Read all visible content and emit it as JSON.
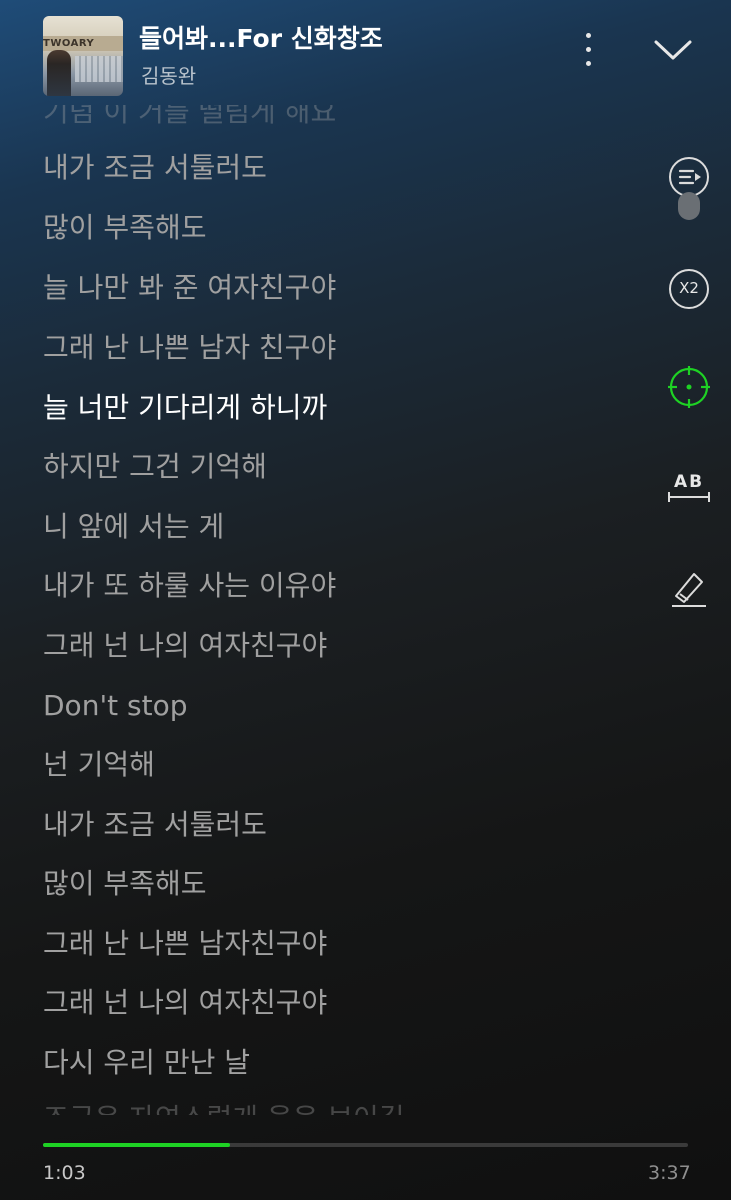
{
  "header": {
    "title": "들어봐...For 신화창조",
    "artist": "김동완",
    "album_art_text": "TWOARY"
  },
  "lyrics": [
    {
      "text": "기념 이 거를 떨림게 해요",
      "state": "fade-top"
    },
    {
      "text": "내가 조금 서툴러도",
      "state": "normal"
    },
    {
      "text": "많이 부족해도",
      "state": "normal"
    },
    {
      "text": "늘 나만 봐 준 여자친구야",
      "state": "normal"
    },
    {
      "text": "그래 난 나쁜 남자 친구야",
      "state": "normal"
    },
    {
      "text": "늘 너만 기다리게 하니까",
      "state": "current"
    },
    {
      "text": "하지만 그건 기억해",
      "state": "normal"
    },
    {
      "text": "니 앞에 서는 게",
      "state": "normal"
    },
    {
      "text": "내가 또 하룰 사는 이유야",
      "state": "normal"
    },
    {
      "text": "그래 넌 나의 여자친구야",
      "state": "normal"
    },
    {
      "text": "Don't stop",
      "state": "normal"
    },
    {
      "text": "넌 기억해",
      "state": "normal"
    },
    {
      "text": "내가 조금 서툴러도",
      "state": "normal"
    },
    {
      "text": "많이 부족해도",
      "state": "normal"
    },
    {
      "text": "그래 난 나쁜 남자친구야",
      "state": "normal"
    },
    {
      "text": "그래 넌 나의 여자친구야",
      "state": "normal"
    },
    {
      "text": "다시 우리 만난 날",
      "state": "normal"
    },
    {
      "text": "조금은 자연스럽게 웃음 보이길",
      "state": "fade-bottom"
    }
  ],
  "tools": {
    "speed_label": "X2",
    "font_size_label": "AB"
  },
  "player": {
    "elapsed": "1:03",
    "total": "3:37",
    "progress": 0.29
  },
  "colors": {
    "accent": "#1ed224",
    "current_lyric": "#ffffff",
    "lyric": "#a0a0a0"
  }
}
